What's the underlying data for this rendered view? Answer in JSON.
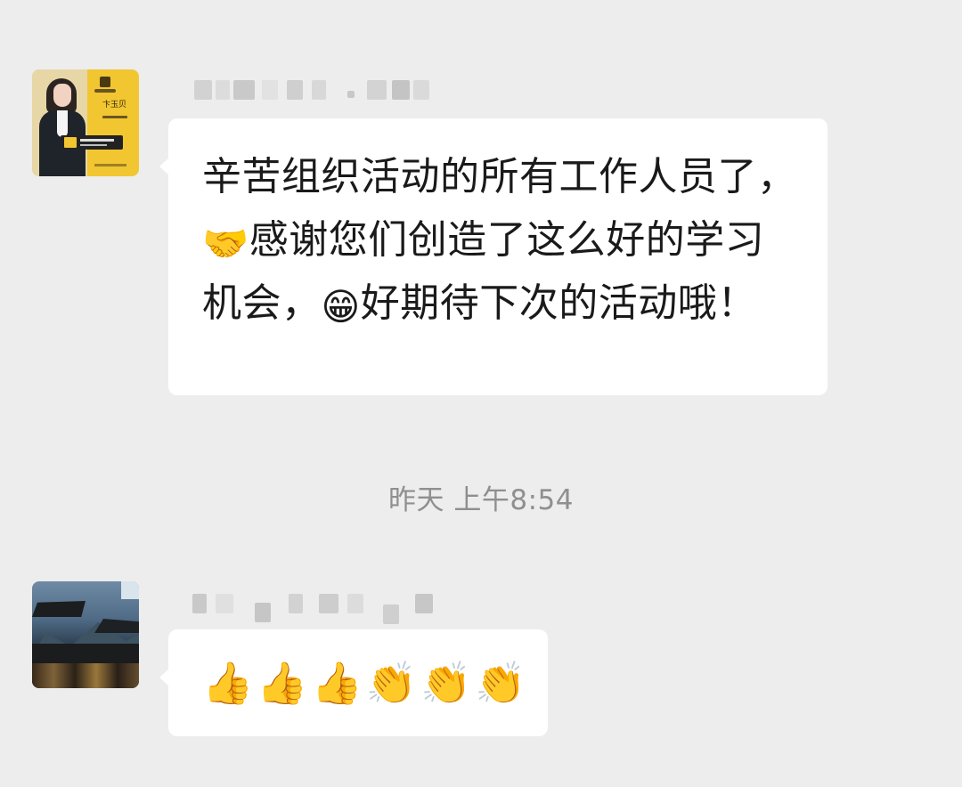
{
  "messages": [
    {
      "sender_card_name": "卞玉贝",
      "text_parts": [
        "辛苦组织活动的所有工作人员了，",
        "感谢您们创造了这么好的学习机会，",
        "好期待下次的活动哦！"
      ],
      "emojis": [
        "🤝",
        "😁"
      ]
    },
    {
      "emojis": [
        "👍",
        "👍",
        "👍",
        "👏",
        "👏",
        "👏"
      ]
    }
  ],
  "timestamp": "昨天 上午8:54",
  "icons": {
    "avatar_1": "business-card-avatar",
    "avatar_2": "landscape-avatar"
  },
  "colors": {
    "background": "#ededed",
    "bubble": "#ffffff",
    "text": "#1a1a1a",
    "timestamp": "#8f8f8f"
  }
}
